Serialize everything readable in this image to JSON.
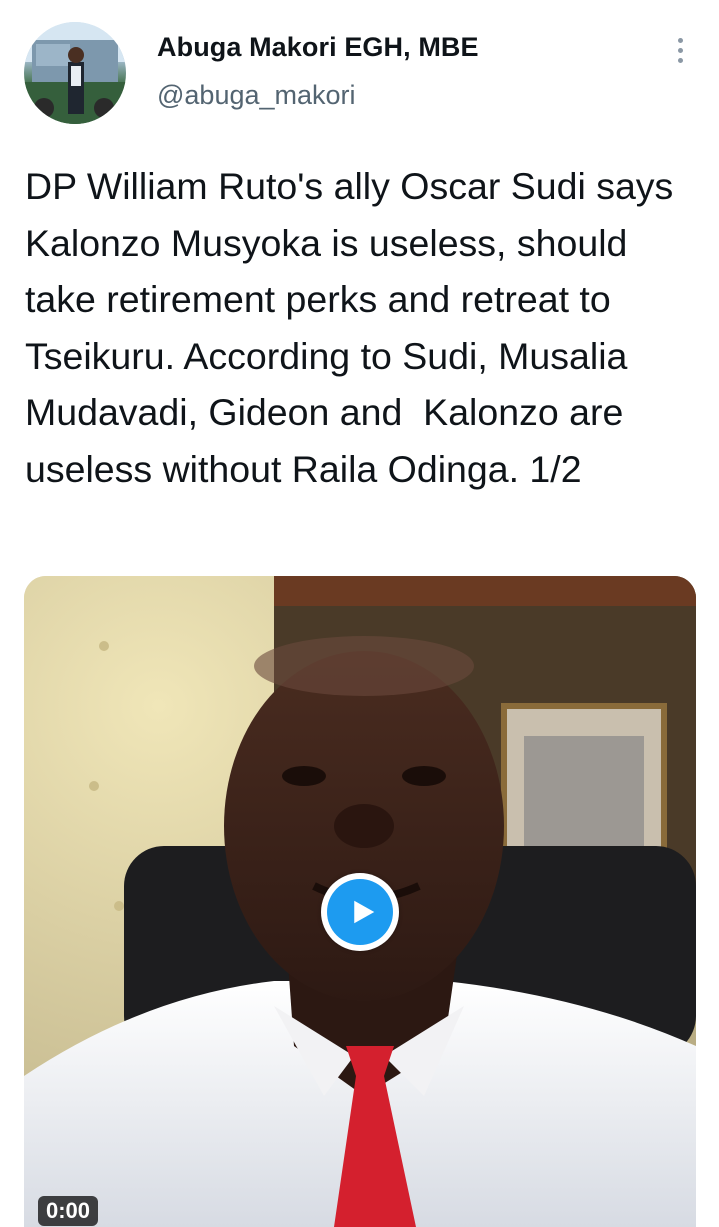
{
  "tweet": {
    "display_name": "Abuga Makori EGH, MBE",
    "handle": "@abuga_makori",
    "text": "DP William Ruto's ally Oscar Sudi says Kalonzo Musyoka is useless, should take retirement perks and retreat to Tseikuru. According to Sudi, Musalia Mudavadi, Gideon and  Kalonzo are useless without Raila Odinga. 1/2",
    "more_icon": "more-vertical-icon",
    "media": {
      "type": "video",
      "play_icon": "play-icon",
      "duration": "0:00"
    }
  },
  "colors": {
    "accent": "#1d9bf0",
    "text_primary": "#0f1419",
    "text_secondary": "#536471"
  }
}
